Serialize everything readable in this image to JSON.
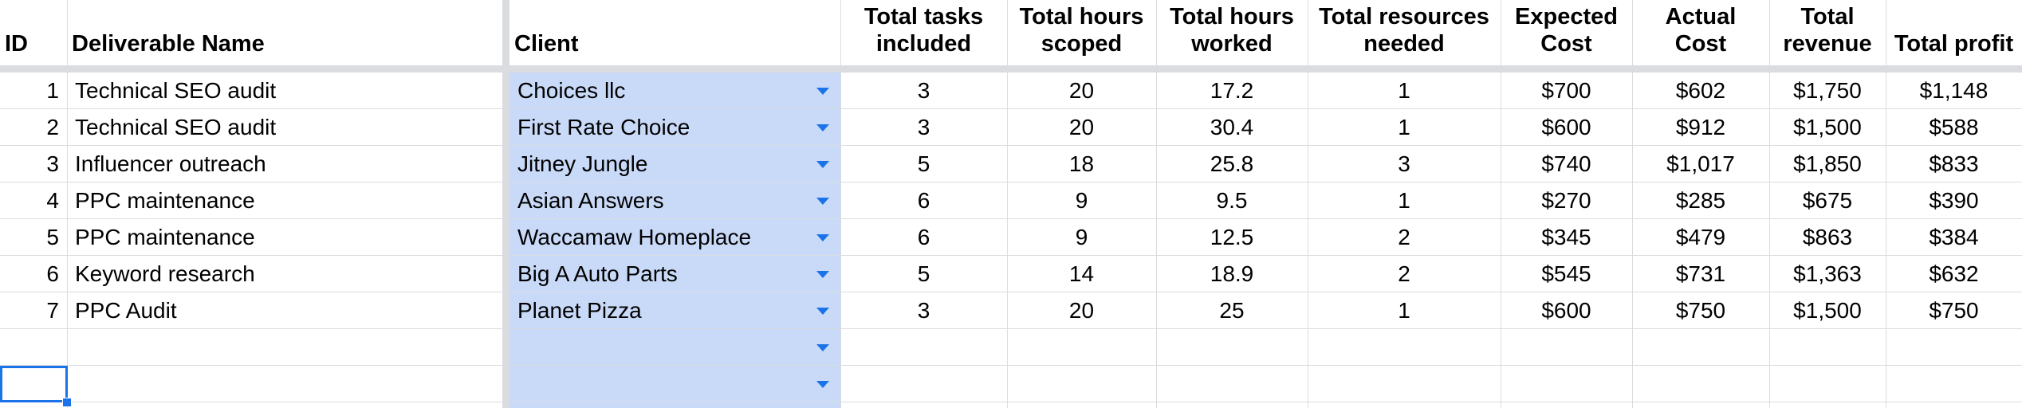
{
  "columns": [
    {
      "key": "id",
      "label": "ID",
      "align": "right",
      "header_align": "left"
    },
    {
      "key": "deliverable_name",
      "label": "Deliverable Name",
      "align": "left",
      "header_align": "left"
    },
    {
      "key": "client",
      "label": "Client",
      "align": "left",
      "header_align": "left"
    },
    {
      "key": "total_tasks_included",
      "label": "Total tasks included",
      "align": "center",
      "header_align": "center"
    },
    {
      "key": "total_hours_scoped",
      "label": "Total hours scoped",
      "align": "center",
      "header_align": "center"
    },
    {
      "key": "total_hours_worked",
      "label": "Total hours worked",
      "align": "center",
      "header_align": "center"
    },
    {
      "key": "total_resources_needed",
      "label": "Total resources needed",
      "align": "center",
      "header_align": "center"
    },
    {
      "key": "expected_cost",
      "label": "Expected Cost",
      "align": "center",
      "header_align": "center"
    },
    {
      "key": "actual_cost",
      "label": "Actual Cost",
      "align": "center",
      "header_align": "center"
    },
    {
      "key": "total_revenue",
      "label": "Total revenue",
      "align": "center",
      "header_align": "center"
    },
    {
      "key": "total_profit",
      "label": "Total profit",
      "align": "center",
      "header_align": "center"
    }
  ],
  "rows": [
    [
      "1",
      "Technical SEO audit",
      "Choices llc",
      "3",
      "20",
      "17.2",
      "1",
      "$700",
      "$602",
      "$1,750",
      "$1,148"
    ],
    [
      "2",
      "Technical SEO audit",
      "First Rate Choice",
      "3",
      "20",
      "30.4",
      "1",
      "$600",
      "$912",
      "$1,500",
      "$588"
    ],
    [
      "3",
      "Influencer outreach",
      "Jitney Jungle",
      "5",
      "18",
      "25.8",
      "3",
      "$740",
      "$1,017",
      "$1,850",
      "$833"
    ],
    [
      "4",
      "PPC maintenance",
      "Asian Answers",
      "6",
      "9",
      "9.5",
      "1",
      "$270",
      "$285",
      "$675",
      "$390"
    ],
    [
      "5",
      "PPC maintenance",
      "Waccamaw Homeplace",
      "6",
      "9",
      "12.5",
      "2",
      "$345",
      "$479",
      "$863",
      "$384"
    ],
    [
      "6",
      "Keyword research",
      "Big A Auto Parts",
      "5",
      "14",
      "18.9",
      "2",
      "$545",
      "$731",
      "$1,363",
      "$632"
    ],
    [
      "7",
      "PPC Audit",
      "Planet Pizza",
      "3",
      "20",
      "25",
      "1",
      "$600",
      "$750",
      "$1,500",
      "$750"
    ]
  ],
  "empty_rows": 2,
  "colors": {
    "client_fill": "#c9daf8",
    "dropdown_arrow": "#1a73e8",
    "grid": "#dadce0",
    "selection": "#1a73e8"
  },
  "icons": {
    "dropdown": "chevron-down-icon"
  }
}
